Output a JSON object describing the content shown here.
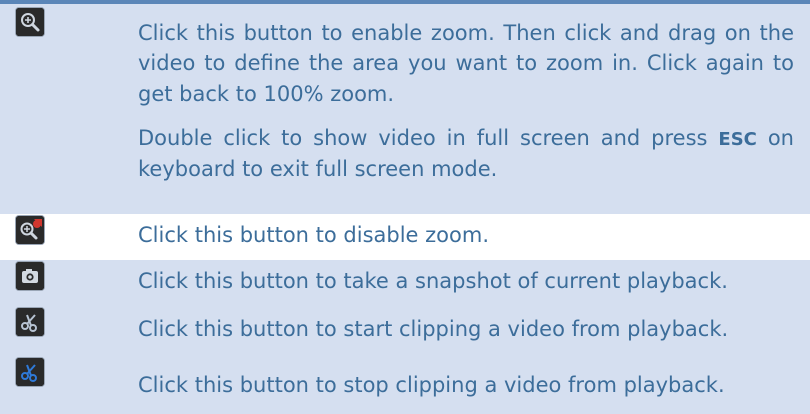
{
  "rows": [
    {
      "icon": "zoom-in-icon",
      "paragraphs": [
        "Click this button to enable zoom. Then click and drag on the video to define the area you want to zoom in. Click again to get back to 100% zoom."
      ],
      "fullscreen": {
        "before": "Double click to show video in full screen and press",
        "key": "ESC",
        "after": "on keyboard to exit full screen mode."
      }
    },
    {
      "icon": "zoom-disable-icon",
      "text": "Click this button to disable zoom."
    },
    {
      "icon": "camera-icon",
      "text": "Click this button to take a snapshot of current playback."
    },
    {
      "icon": "scissors-icon",
      "text": "Click this button to start clipping a video from playback."
    },
    {
      "icon": "scissors-active-icon",
      "text": "Click this button to stop clipping a video from playback."
    }
  ],
  "colors": {
    "text": "#3c6d9a",
    "row_background": "#d5dff0",
    "top_rule": "#5b86b8",
    "scissors_normal": "#b7c3d2",
    "scissors_active": "#2f7ad8",
    "zoom_disable_badge": "#d0362e"
  }
}
